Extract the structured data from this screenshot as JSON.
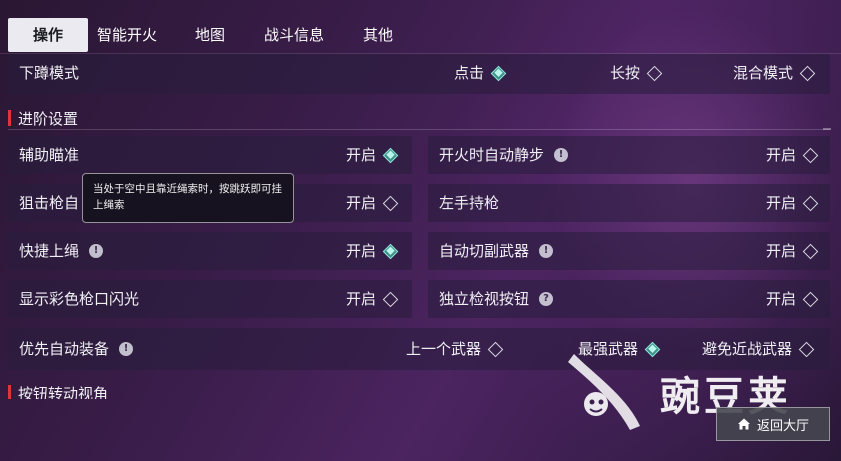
{
  "tabs": [
    {
      "label": "操作",
      "active": true
    },
    {
      "label": "智能开火",
      "active": false
    },
    {
      "label": "地图",
      "active": false
    },
    {
      "label": "战斗信息",
      "active": false
    },
    {
      "label": "其他",
      "active": false
    }
  ],
  "crouch_row": {
    "label": "下蹲模式",
    "options": [
      {
        "label": "点击",
        "checked": true
      },
      {
        "label": "长按",
        "checked": false
      },
      {
        "label": "混合模式",
        "checked": false
      }
    ]
  },
  "advanced_section": {
    "title": "进阶设置"
  },
  "settings": {
    "aim_assist": {
      "label": "辅助瞄准",
      "value": "开启",
      "checked": true
    },
    "auto_silent_walk": {
      "label": "开火时自动静步",
      "value": "开启",
      "checked": false
    },
    "sniper_auto": {
      "label": "狙击枪自",
      "value": "开启",
      "checked": false
    },
    "left_hand": {
      "label": "左手持枪",
      "value": "开启",
      "checked": false
    },
    "quick_rope": {
      "label": "快捷上绳",
      "value": "开启",
      "checked": true
    },
    "auto_switch_secondary": {
      "label": "自动切副武器",
      "value": "开启",
      "checked": false
    },
    "color_muzzle_flash": {
      "label": "显示彩色枪口闪光",
      "value": "开启",
      "checked": false
    },
    "inspect_button": {
      "label": "独立检视按钮",
      "value": "开启",
      "checked": false
    }
  },
  "auto_equip_row": {
    "label": "优先自动装备",
    "options": [
      {
        "label": "上一个武器",
        "checked": false
      },
      {
        "label": "最强武器",
        "checked": true
      },
      {
        "label": "避免近战武器",
        "checked": false
      }
    ]
  },
  "next_section": {
    "title": "按钮转动视角"
  },
  "tooltip": {
    "text": "当处于空中且靠近绳索时，按跳跃即可挂上绳索"
  },
  "watermark": {
    "text": "豌豆荚"
  },
  "back_button": {
    "label": "返回大厅"
  },
  "colors": {
    "accent_red": "#e0323f",
    "checked_teal": "#3f8f87"
  }
}
